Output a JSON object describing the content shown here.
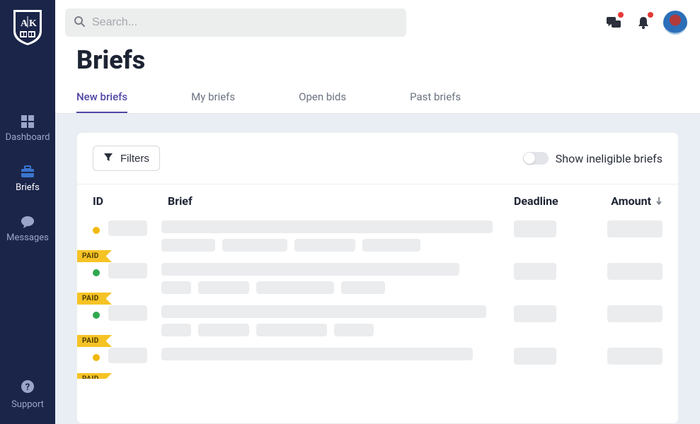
{
  "sidebar": {
    "items": [
      {
        "label": "Dashboard",
        "icon": "dashboard-icon"
      },
      {
        "label": "Briefs",
        "icon": "briefcase-icon"
      },
      {
        "label": "Messages",
        "icon": "chat-icon"
      }
    ],
    "support_label": "Support"
  },
  "search": {
    "placeholder": "Search..."
  },
  "page": {
    "title": "Briefs"
  },
  "tabs": [
    {
      "label": "New briefs",
      "active": true
    },
    {
      "label": "My briefs"
    },
    {
      "label": "Open bids"
    },
    {
      "label": "Past briefs"
    }
  ],
  "toolbar": {
    "filters_label": "Filters",
    "toggle_label": "Show ineligible briefs",
    "toggle_on": false
  },
  "columns": {
    "id": "ID",
    "brief": "Brief",
    "deadline": "Deadline",
    "amount": "Amount"
  },
  "rows": [
    {
      "status": "yellow",
      "paid": false
    },
    {
      "status": "green",
      "paid": true
    },
    {
      "status": "green",
      "paid": true
    },
    {
      "status": "yellow",
      "paid": true
    },
    {
      "status": "yellow",
      "paid": true
    }
  ],
  "badges": {
    "paid_label": "PAID"
  }
}
